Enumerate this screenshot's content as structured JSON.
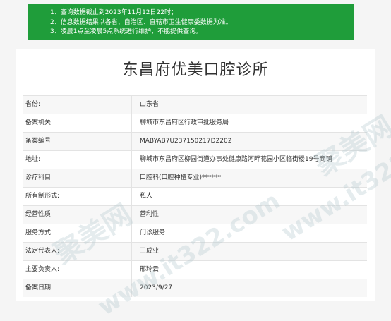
{
  "notice": {
    "lines": [
      "1、查询数据截止到2023年11月12日22时；",
      "2、信息数据结果以各省、自治区、直辖市卫生健康委数据为准。",
      "3、凌晨1点至凌晨5点系统进行维护，不能提供查询。"
    ]
  },
  "clinic": {
    "title": "东昌府优美口腔诊所"
  },
  "fields": [
    {
      "label": "省份:",
      "value": "山东省"
    },
    {
      "label": "备案机关:",
      "value": "聊城市东昌府区行政审批服务局"
    },
    {
      "label": "备案编号:",
      "value": "MABYAB7U237150217D2202"
    },
    {
      "label": "地址:",
      "value": "聊城市东昌府区柳园街道办事处健康路河畔花园小区临街楼19号商铺"
    },
    {
      "label": "诊疗科目:",
      "value": "口腔科(口腔种植专业)******"
    },
    {
      "label": "所有制形式:",
      "value": "私人"
    },
    {
      "label": "经营性质:",
      "value": "营利性"
    },
    {
      "label": "服务方式:",
      "value": "门诊服务"
    },
    {
      "label": "法定代表人:",
      "value": "王成业"
    },
    {
      "label": "主要负责人:",
      "value": "邢玲云"
    },
    {
      "label": "备案日期:",
      "value": "2023/9/27"
    }
  ],
  "watermark": {
    "text1": "聚美网",
    "text2": "www.it322.com"
  },
  "colors": {
    "notice_bg": "#1f9d3a",
    "title": "#333333"
  }
}
